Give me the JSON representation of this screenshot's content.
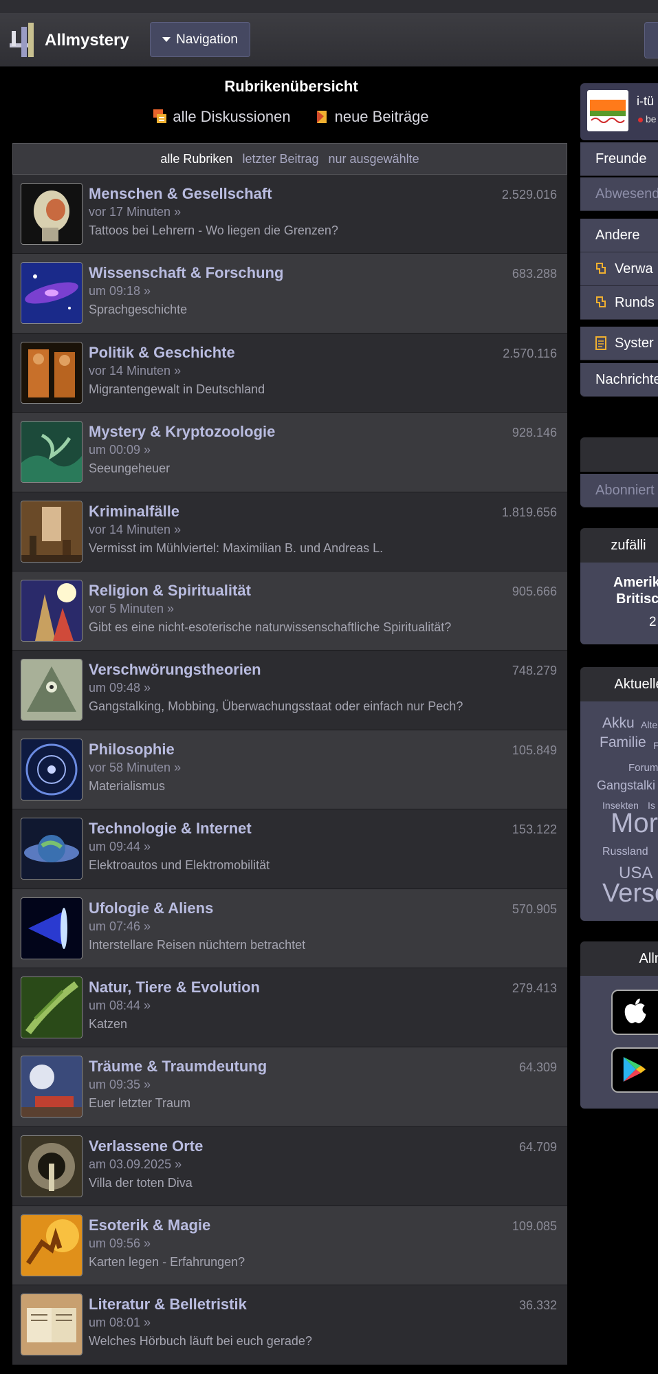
{
  "header": {
    "brand": "Allmystery",
    "nav_label": "Navigation"
  },
  "main": {
    "title": "Rubrikenübersicht",
    "links": [
      "alle Diskussionen",
      "neue Beiträge"
    ],
    "filters": [
      "alle Rubriken",
      "letzter Beitrag",
      "nur ausgewählte"
    ]
  },
  "categories": [
    {
      "name": "Menschen & Gesellschaft",
      "time": "vor 17 Minuten »",
      "topic": "Tattoos bei Lehrern - Wo liegen die Grenzen?",
      "count": "2.529.016"
    },
    {
      "name": "Wissenschaft & Forschung",
      "time": "um 09:18 »",
      "topic": "Sprachgeschichte",
      "count": "683.288"
    },
    {
      "name": "Politik & Geschichte",
      "time": "vor 14 Minuten »",
      "topic": "Migrantengewalt in Deutschland",
      "count": "2.570.116"
    },
    {
      "name": "Mystery & Kryptozoologie",
      "time": "um 00:09 »",
      "topic": "Seeungeheuer",
      "count": "928.146"
    },
    {
      "name": "Kriminalfälle",
      "time": "vor 14 Minuten »",
      "topic": "Vermisst im Mühlviertel: Maximilian B. und Andreas L.",
      "count": "1.819.656"
    },
    {
      "name": "Religion & Spiritualität",
      "time": "vor 5 Minuten »",
      "topic": "Gibt es eine nicht-esoterische naturwissenschaftliche Spiritualität?",
      "count": "905.666"
    },
    {
      "name": "Verschwörungstheorien",
      "time": "um 09:48 »",
      "topic": "Gangstalking, Mobbing, Überwachungsstaat oder einfach nur Pech?",
      "count": "748.279"
    },
    {
      "name": "Philosophie",
      "time": "vor 58 Minuten »",
      "topic": "Materialismus",
      "count": "105.849"
    },
    {
      "name": "Technologie & Internet",
      "time": "um 09:44 »",
      "topic": "Elektroautos und Elektromobilität",
      "count": "153.122"
    },
    {
      "name": "Ufologie & Aliens",
      "time": "um 07:46 »",
      "topic": "Interstellare Reisen nüchtern betrachtet",
      "count": "570.905"
    },
    {
      "name": "Natur, Tiere & Evolution",
      "time": "um 08:44 »",
      "topic": "Katzen",
      "count": "279.413"
    },
    {
      "name": "Träume & Traumdeutung",
      "time": "um 09:35 »",
      "topic": "Euer letzter Traum",
      "count": "64.309"
    },
    {
      "name": "Verlassene Orte",
      "time": "am 03.09.2025 »",
      "topic": "Villa der toten Diva",
      "count": "64.709"
    },
    {
      "name": "Esoterik & Magie",
      "time": "um 09:56 »",
      "topic": "Karten legen - Erfahrungen?",
      "count": "109.085"
    },
    {
      "name": "Literatur & Belletristik",
      "time": "um 08:01 »",
      "topic": "Welches Hörbuch läuft bei euch gerade?",
      "count": "36.332"
    }
  ],
  "sidebar": {
    "user_name": "i-tü",
    "user_status": "be",
    "items": [
      "Freunde",
      "Abwesend",
      "Andere",
      "Verwa",
      "Runds",
      "Syster",
      "Nachrichte"
    ],
    "subscribed": "Abonniert",
    "random_head": "zufälli",
    "random_lines": [
      "Amerik",
      "Britisc",
      "2"
    ],
    "current_head": "Aktuelle",
    "tags": [
      "Akku",
      "Alte",
      "Familie",
      "F",
      "Forum",
      "Gangstalki",
      "Insekten",
      "Is",
      "Mor",
      "Russland",
      "USA",
      "Verso"
    ],
    "apps_head": "Allm"
  }
}
